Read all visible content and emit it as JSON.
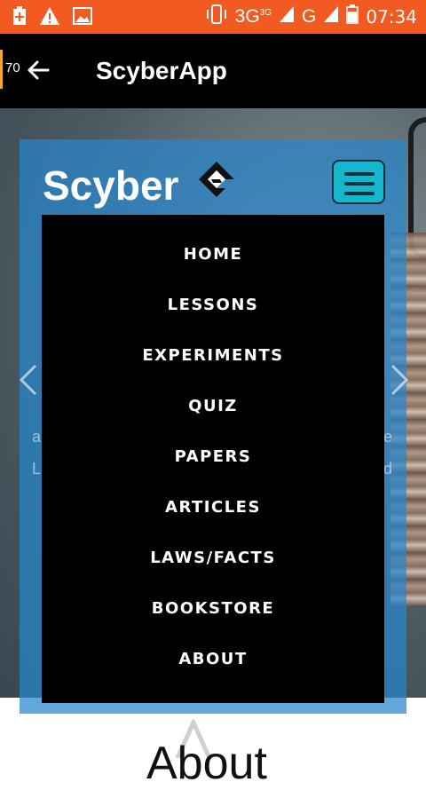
{
  "status_bar": {
    "network_label": "3G",
    "network_sup": "3G",
    "network_g": "G",
    "time": "07:34"
  },
  "app_bar": {
    "counter": "70",
    "title": "ScyberApp"
  },
  "header": {
    "brand": "Scyber"
  },
  "slider": {
    "left_ghost_1": "a",
    "left_ghost_2": "L",
    "right_ghost_1": "e",
    "right_ghost_2": "d"
  },
  "menu": {
    "items": [
      {
        "label": "HOME"
      },
      {
        "label": "LESSONS"
      },
      {
        "label": "EXPERIMENTS"
      },
      {
        "label": "QUIZ"
      },
      {
        "label": "PAPERS"
      },
      {
        "label": "ARTICLES"
      },
      {
        "label": "LAWS/FACTS"
      },
      {
        "label": "BOOKSTORE"
      },
      {
        "label": "ABOUT"
      }
    ]
  },
  "about": {
    "heading": "About"
  },
  "colors": {
    "status_bar": "#f25a22",
    "app_bar": "#000000",
    "panel_blue": "#2687cd",
    "hamburger": "#17b6cf",
    "menu_bg": "#000000"
  }
}
